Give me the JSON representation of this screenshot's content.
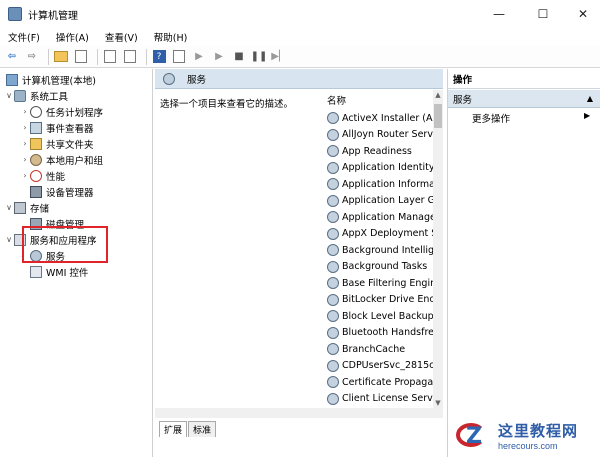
{
  "window": {
    "title": "计算机管理",
    "minimize": "—",
    "maximize": "☐",
    "close": "✕"
  },
  "menu": [
    "文件(F)",
    "操作(A)",
    "查看(V)",
    "帮助(H)"
  ],
  "tree": {
    "root": "计算机管理(本地)",
    "system_tools": "系统工具",
    "task_scheduler": "任务计划程序",
    "event_viewer": "事件查看器",
    "shared_folders": "共享文件夹",
    "local_users": "本地用户和组",
    "performance": "性能",
    "device_manager": "设备管理器",
    "storage": "存储",
    "disk_management": "磁盘管理",
    "services_apps": "服务和应用程序",
    "services": "服务",
    "wmi": "WMI 控件"
  },
  "middle": {
    "header": "服务",
    "description": "选择一个项目来查看它的描述。",
    "column_name": "名称",
    "services": [
      "ActiveX Installer (Ax",
      "AllJoyn Router Serv",
      "App Readiness",
      "Application Identity",
      "Application Informa",
      "Application Layer G",
      "Application Manage",
      "AppX Deployment S",
      "Background Intellig",
      "Background Tasks",
      "Base Filtering Engin",
      "BitLocker Drive Enc",
      "Block Level Backup",
      "Bluetooth Handsfre",
      "BranchCache",
      "CDPUserSvc_2815c",
      "Certificate Propaga",
      "Client License Servic"
    ],
    "tabs": [
      "扩展",
      "标准"
    ]
  },
  "actions": {
    "title": "操作",
    "section": "服务",
    "more": "更多操作"
  },
  "watermark": {
    "cn": "这里教程网",
    "en": "herecours.com"
  },
  "colors": {
    "highlight": "#e0242a",
    "header_bg": "#d8e4ef",
    "accent_blue": "#2e76c8"
  }
}
